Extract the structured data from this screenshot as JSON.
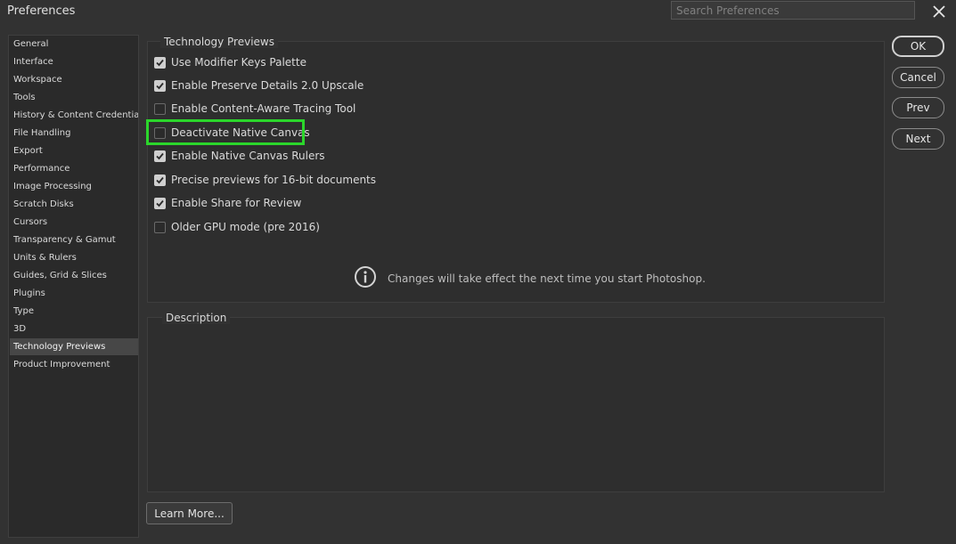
{
  "window": {
    "title": "Preferences"
  },
  "search": {
    "placeholder": "Search Preferences"
  },
  "sidebar": {
    "items": [
      {
        "label": "General"
      },
      {
        "label": "Interface"
      },
      {
        "label": "Workspace"
      },
      {
        "label": "Tools"
      },
      {
        "label": "History & Content Credentials"
      },
      {
        "label": "File Handling"
      },
      {
        "label": "Export"
      },
      {
        "label": "Performance"
      },
      {
        "label": "Image Processing"
      },
      {
        "label": "Scratch Disks"
      },
      {
        "label": "Cursors"
      },
      {
        "label": "Transparency & Gamut"
      },
      {
        "label": "Units & Rulers"
      },
      {
        "label": "Guides, Grid & Slices"
      },
      {
        "label": "Plugins"
      },
      {
        "label": "Type"
      },
      {
        "label": "3D"
      },
      {
        "label": "Technology Previews",
        "selected": true
      },
      {
        "label": "Product Improvement"
      }
    ]
  },
  "tech_previews": {
    "title": "Technology Previews",
    "options": [
      {
        "label": "Use Modifier Keys Palette",
        "checked": true
      },
      {
        "label": "Enable Preserve Details 2.0 Upscale",
        "checked": true
      },
      {
        "label": "Enable Content-Aware Tracing Tool",
        "checked": false
      },
      {
        "label": "Deactivate Native Canvas",
        "checked": false,
        "highlighted": true
      },
      {
        "label": "Enable Native Canvas Rulers",
        "checked": true
      },
      {
        "label": "Precise previews for 16-bit documents",
        "checked": true
      },
      {
        "label": "Enable Share for Review",
        "checked": true
      },
      {
        "label": "Older GPU mode (pre 2016)",
        "checked": false
      }
    ],
    "notice": {
      "icon": "info-icon",
      "text": "Changes will take effect the next time you start Photoshop."
    }
  },
  "description": {
    "title": "Description"
  },
  "buttons": {
    "ok": "OK",
    "cancel": "Cancel",
    "prev": "Prev",
    "next": "Next",
    "learn_more": "Learn More..."
  },
  "colors": {
    "background": "#323232",
    "panel": "#2e2e2e",
    "highlight": "#2bd62b",
    "text": "#d6d6d6"
  }
}
